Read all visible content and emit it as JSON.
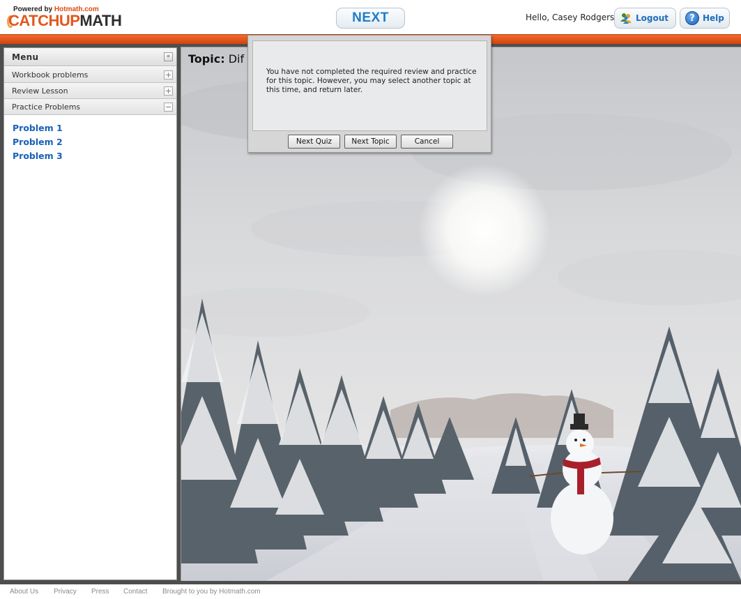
{
  "header": {
    "powered_by_prefix": "Powered by ",
    "powered_by_brand": "Hotmath.com",
    "logo_catchup": "CATCHUP",
    "logo_math": "MATH",
    "next_label": "NEXT",
    "greeting": "Hello, Casey Rodgers",
    "logout_label": "Logout",
    "help_label": "Help",
    "help_glyph": "?"
  },
  "sidebar": {
    "title": "Menu",
    "collapse_glyph": "«",
    "sections": [
      {
        "label": "Workbook problems",
        "toggle": "+"
      },
      {
        "label": "Review Lesson",
        "toggle": "+"
      },
      {
        "label": "Practice Problems",
        "toggle": "−"
      }
    ],
    "problems": [
      "Problem 1",
      "Problem 2",
      "Problem 3"
    ]
  },
  "content": {
    "topic_prefix": "Topic:",
    "topic_name": "Dif"
  },
  "dialog": {
    "message": "You have not completed the required review and practice for this topic. However, you may select another topic at this time, and return later.",
    "next_quiz": "Next Quiz",
    "next_topic": "Next Topic",
    "cancel": "Cancel"
  },
  "footer": {
    "links": [
      "About Us",
      "Privacy",
      "Press",
      "Contact",
      "Brought to you by Hotmath.com"
    ]
  },
  "colors": {
    "accent_orange": "#e2571c",
    "link_blue": "#1961b6",
    "button_blue": "#1f7cc8"
  }
}
